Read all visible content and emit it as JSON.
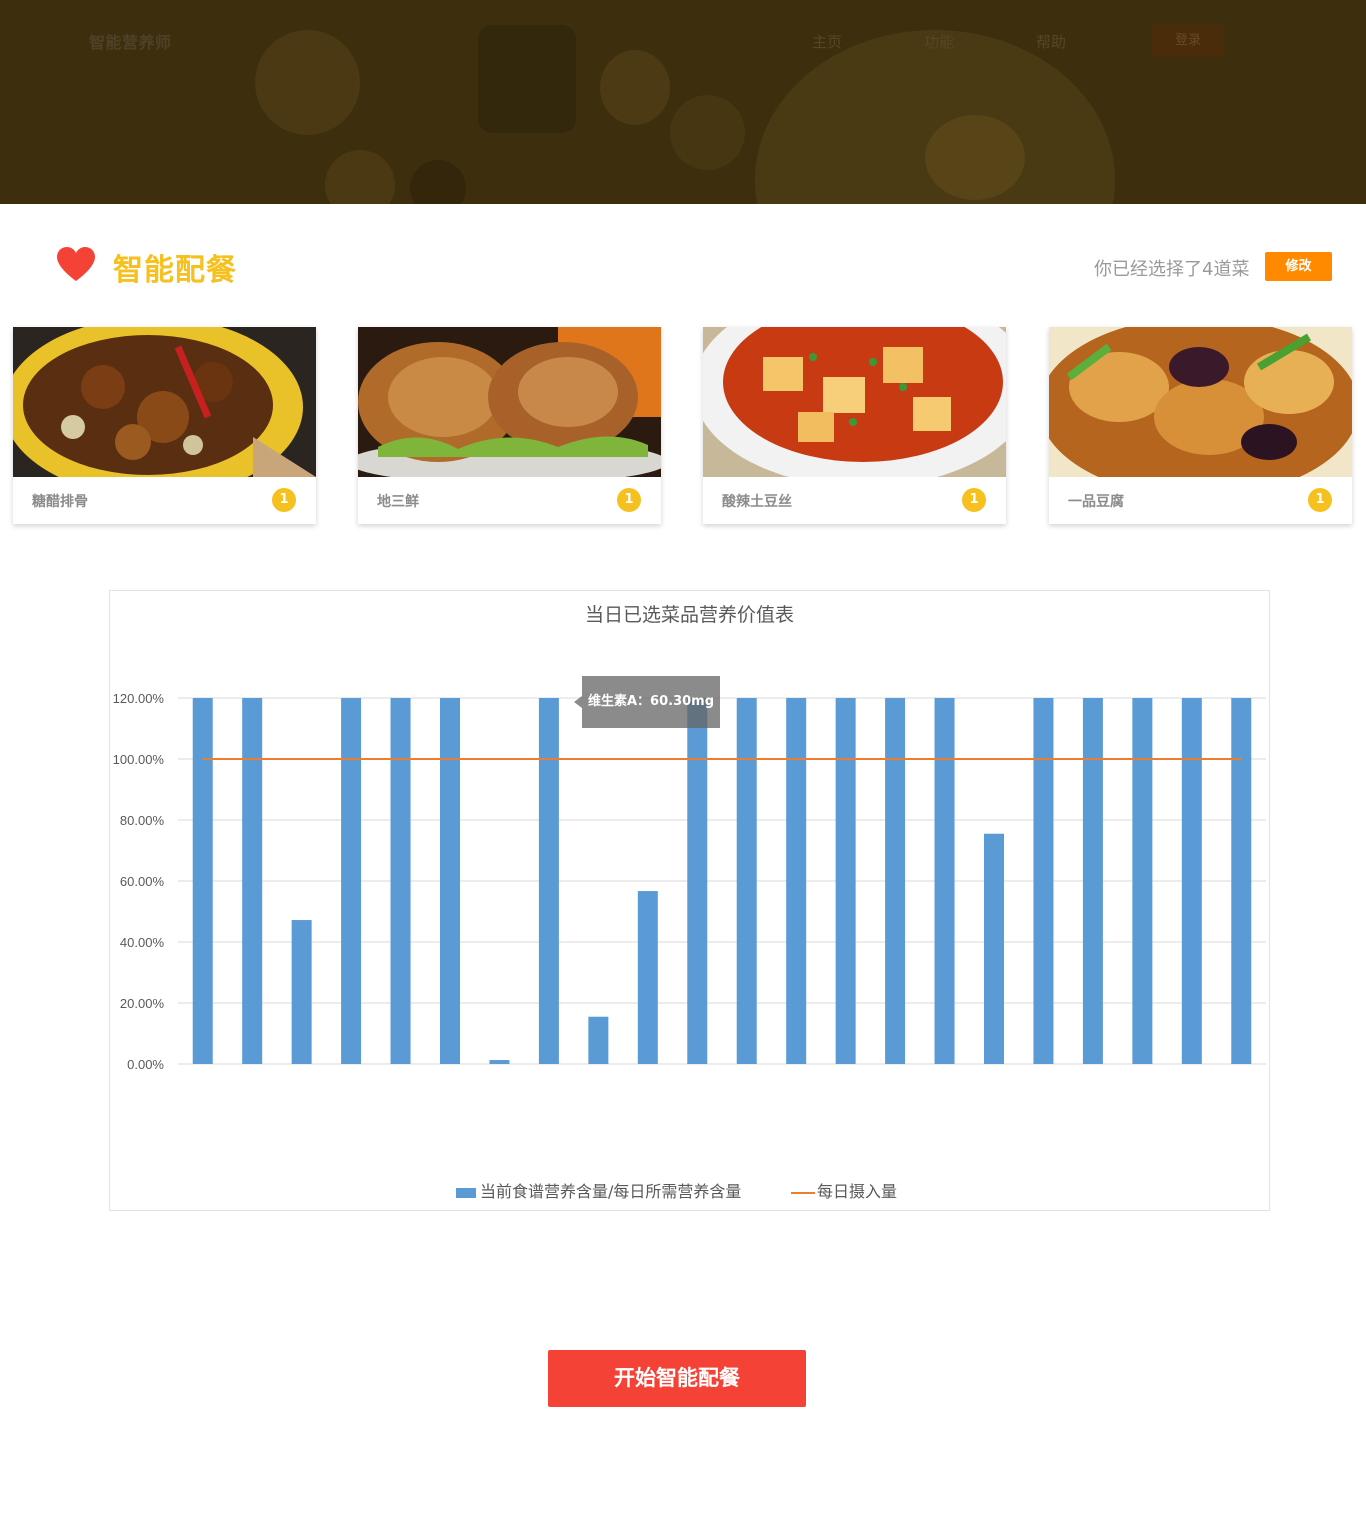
{
  "header": {
    "logo": "智能营养师",
    "nav": [
      "主页",
      "功能",
      "帮助"
    ],
    "login_label": "登录"
  },
  "section": {
    "title": "智能配餐",
    "selected_text": "你已经选择了4道菜",
    "modify_label": "修改"
  },
  "dishes": [
    {
      "name": "糖醋排骨",
      "count": "1"
    },
    {
      "name": "地三鲜",
      "count": "1"
    },
    {
      "name": "酸辣土豆丝",
      "count": "1"
    },
    {
      "name": "一品豆腐",
      "count": "1"
    }
  ],
  "tooltip": "维生素A：60.30mg",
  "start_label": "开始智能配餐",
  "colors": {
    "accent_yellow": "#f6c01e",
    "accent_orange": "#ff8a00",
    "start_red": "#f44336",
    "bar_blue": "#5b9bd5",
    "line_orange": "#ed7d31"
  },
  "chart_data": {
    "type": "bar",
    "title": "当日已选菜品营养价值表",
    "ylim": [
      0,
      1.2
    ],
    "yticks": [
      "0.00%",
      "20.00%",
      "40.00%",
      "60.00%",
      "80.00%",
      "100.00%",
      "120.00%"
    ],
    "grid": true,
    "legend_position": "bottom",
    "series": [
      {
        "name": "当前食谱营养含量/每日所需营养含量",
        "values": [
          1.2,
          1.2,
          0.472,
          1.2,
          1.2,
          1.2,
          0.013,
          1.2,
          0.155,
          0.567,
          1.2,
          1.2,
          1.2,
          1.2,
          1.2,
          1.2,
          0.755,
          1.2,
          1.2,
          1.2,
          1.2,
          1.2
        ]
      },
      {
        "name": "每日摄入量",
        "type": "line",
        "values": [
          1.0,
          1.0,
          1.0,
          1.0,
          1.0,
          1.0,
          1.0,
          1.0,
          1.0,
          1.0,
          1.0,
          1.0,
          1.0,
          1.0,
          1.0,
          1.0,
          1.0,
          1.0,
          1.0,
          1.0,
          1.0,
          1.0
        ]
      }
    ]
  }
}
